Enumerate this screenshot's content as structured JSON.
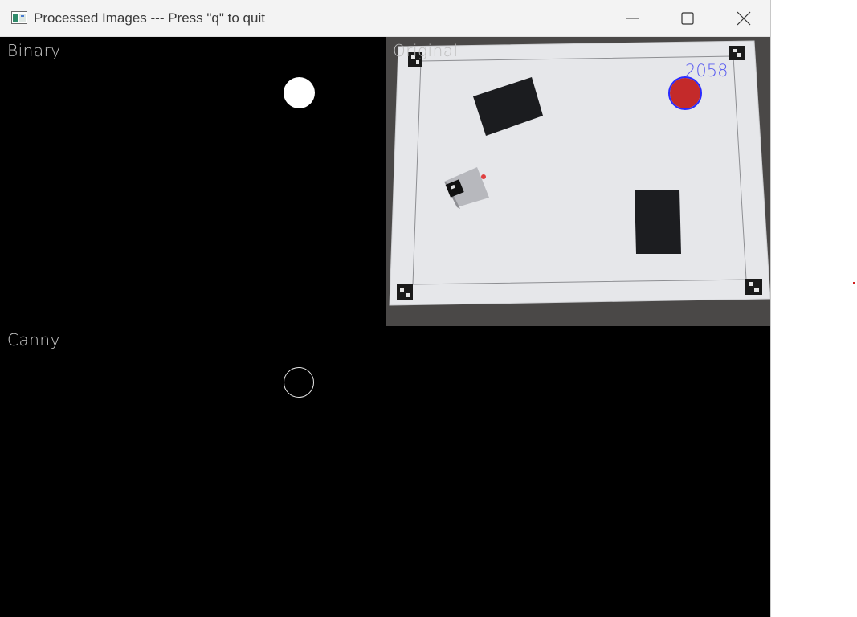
{
  "window": {
    "title": "Processed Images --- Press \"q\" to quit",
    "controls": {
      "minimize_icon": "minimize-icon",
      "maximize_icon": "maximize-icon",
      "close_icon": "close-icon"
    }
  },
  "panels": {
    "binary": {
      "label": "Binary"
    },
    "canny": {
      "label": "Canny"
    },
    "original": {
      "label": "Original",
      "detected_area": "2058"
    }
  },
  "colors": {
    "annotation_text": "#5a5cf0",
    "ball_fill": "#c42a2a",
    "ball_outline": "#2a2aff",
    "background": "#000000"
  }
}
